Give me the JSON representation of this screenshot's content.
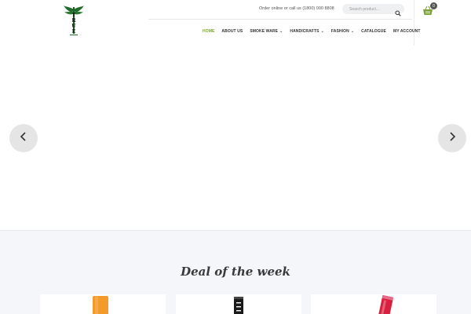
{
  "header": {
    "logo_alt": "TRUE logo",
    "order_text": "Order online or call us (1800) 000 8808",
    "search_placeholder": "Search product...",
    "cart_count": "0"
  },
  "nav": {
    "items": [
      {
        "label": "HOME",
        "active": true,
        "dropdown": false
      },
      {
        "label": "ABOUT US",
        "active": false,
        "dropdown": false
      },
      {
        "label": "SMOKE WARE",
        "active": false,
        "dropdown": true
      },
      {
        "label": "HANDICRAFTS",
        "active": false,
        "dropdown": true
      },
      {
        "label": "FASHION",
        "active": false,
        "dropdown": true
      },
      {
        "label": "CATALOGUE",
        "active": false,
        "dropdown": false
      },
      {
        "label": "MY ACCOUNT",
        "active": false,
        "dropdown": false
      }
    ]
  },
  "slider": {
    "prev_icon": "chevron-left-icon",
    "next_icon": "chevron-right-icon"
  },
  "deals": {
    "title": "Deal of the week",
    "products": [
      {
        "name": "orange-bottle-product",
        "color": "#f39a2a"
      },
      {
        "name": "black-bong-product",
        "color": "#1a1a1a"
      },
      {
        "name": "red-bong-product",
        "color": "#d8203f"
      }
    ]
  },
  "colors": {
    "accent": "#7ba238",
    "logo_green": "#1f6b2a",
    "deals_bg": "#f5f6fa"
  }
}
